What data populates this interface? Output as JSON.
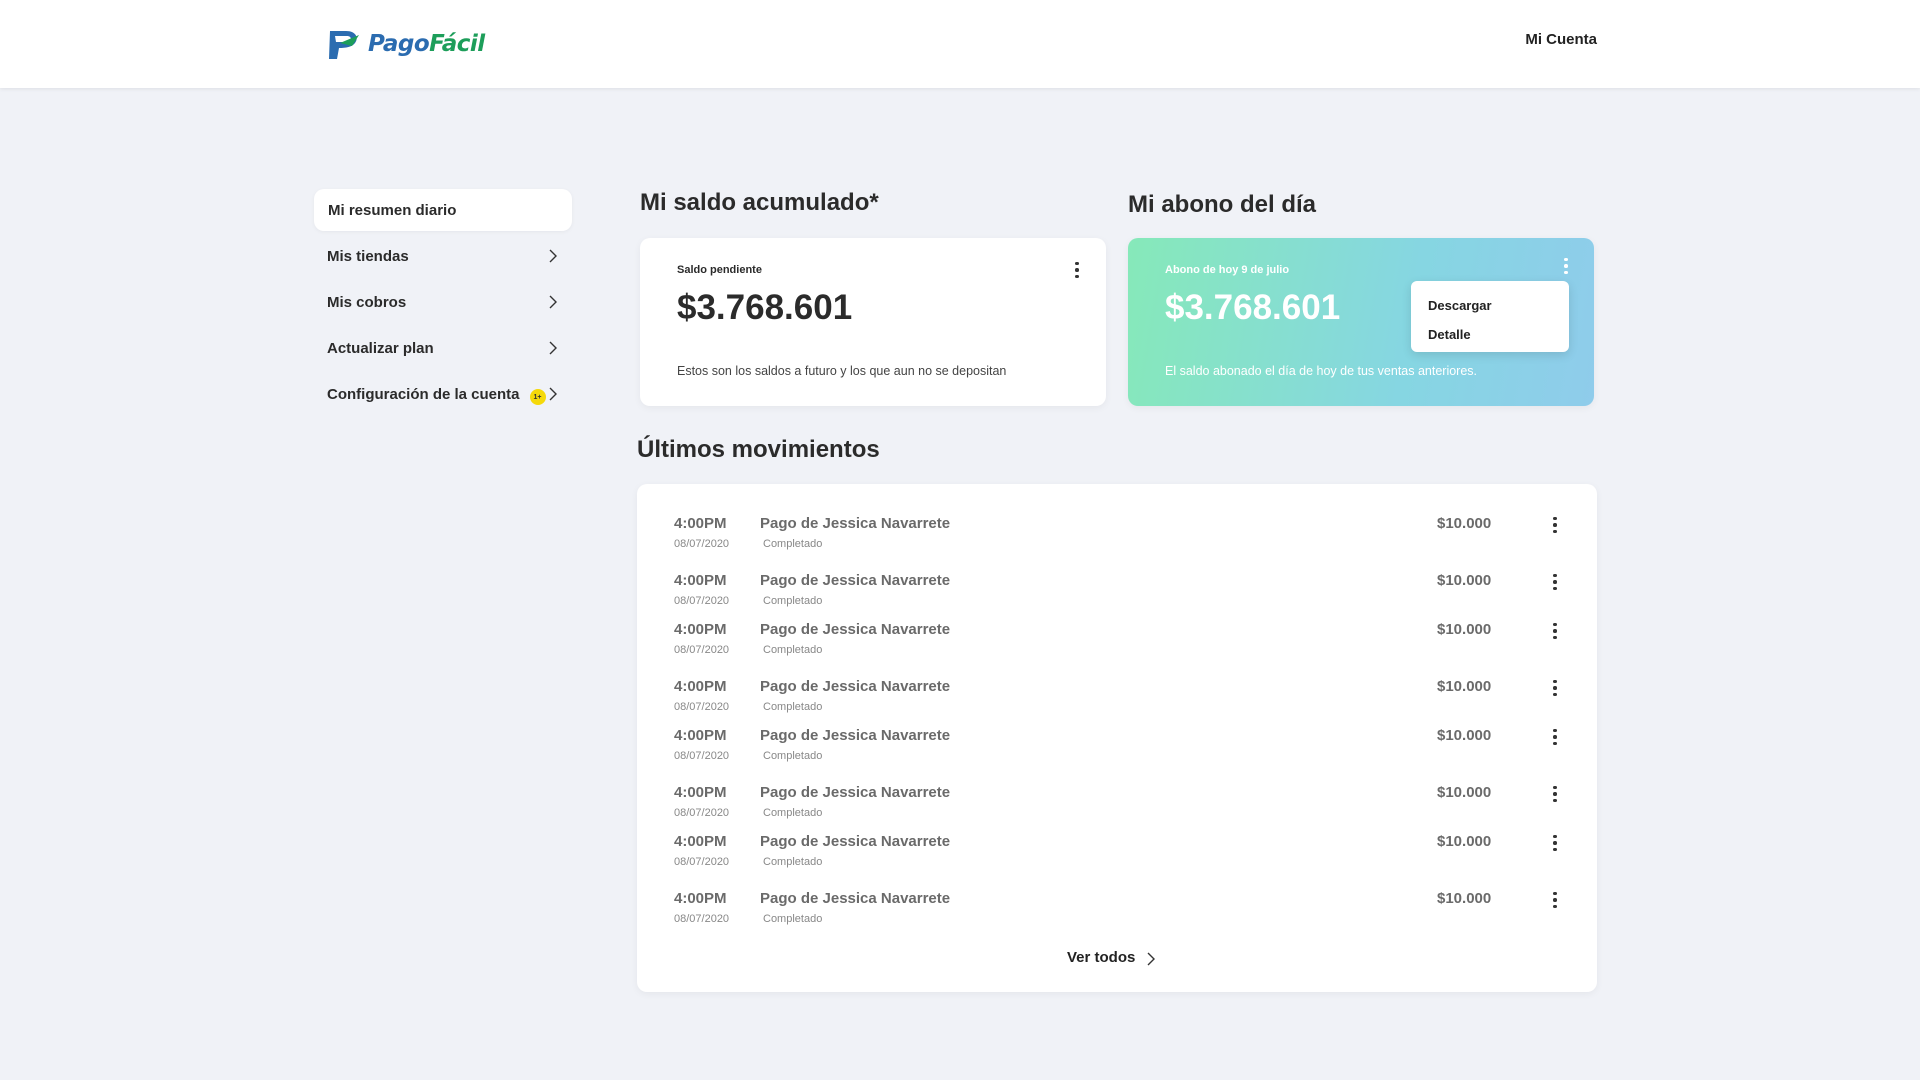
{
  "header": {
    "logo_part1": "Pago",
    "logo_part2": "Fácil",
    "account_label": "Mi Cuenta"
  },
  "sidebar": {
    "items": [
      {
        "label": "Mi resumen diario"
      },
      {
        "label": "Mis tiendas"
      },
      {
        "label": "Mis cobros"
      },
      {
        "label": "Actualizar plan"
      },
      {
        "label": "Configuración de la cuenta",
        "badge": "1+"
      }
    ]
  },
  "balance": {
    "title": "Mi saldo acumulado*",
    "label": "Saldo pendiente",
    "amount": "$3.768.601",
    "description": "Estos son los saldos a futuro y los que aun no se depositan"
  },
  "deposit": {
    "title": "Mi abono del día",
    "label": "Abono de hoy 9 de julio",
    "amount": "$3.768.601",
    "description": "El saldo abonado el día de hoy de tus ventas anteriores.",
    "menu": [
      "Descargar",
      "Detalle"
    ]
  },
  "movements": {
    "title": "Últimos movimientos",
    "rows": [
      {
        "time": "4:00PM",
        "date": "08/07/2020",
        "description": "Pago de Jessica Navarrete",
        "status": "Completado",
        "amount": "$10.000"
      },
      {
        "time": "4:00PM",
        "date": "08/07/2020",
        "description": "Pago de Jessica Navarrete",
        "status": "Completado",
        "amount": "$10.000"
      },
      {
        "time": "4:00PM",
        "date": "08/07/2020",
        "description": "Pago de Jessica Navarrete",
        "status": "Completado",
        "amount": "$10.000"
      },
      {
        "time": "4:00PM",
        "date": "08/07/2020",
        "description": "Pago de Jessica Navarrete",
        "status": "Completado",
        "amount": "$10.000"
      },
      {
        "time": "4:00PM",
        "date": "08/07/2020",
        "description": "Pago de Jessica Navarrete",
        "status": "Completado",
        "amount": "$10.000"
      },
      {
        "time": "4:00PM",
        "date": "08/07/2020",
        "description": "Pago de Jessica Navarrete",
        "status": "Completado",
        "amount": "$10.000"
      },
      {
        "time": "4:00PM",
        "date": "08/07/2020",
        "description": "Pago de Jessica Navarrete",
        "status": "Completado",
        "amount": "$10.000"
      },
      {
        "time": "4:00PM",
        "date": "08/07/2020",
        "description": "Pago de Jessica Navarrete",
        "status": "Completado",
        "amount": "$10.000"
      }
    ],
    "see_all": "Ver todos"
  },
  "colors": {
    "brand_blue": "#2b6cb0",
    "brand_green": "#1d9e5a",
    "background": "#f0f2f7",
    "badge": "#f5d90a"
  }
}
